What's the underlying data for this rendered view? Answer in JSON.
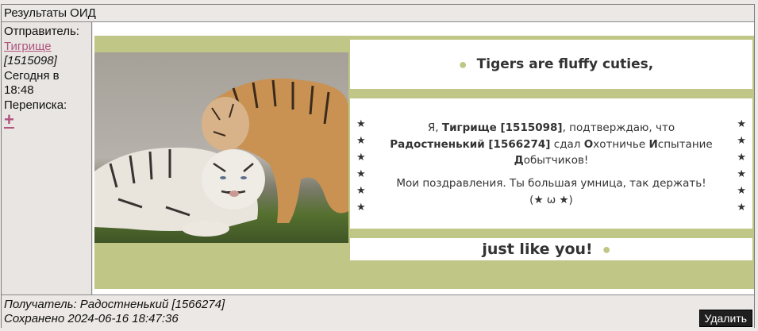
{
  "header": {
    "title": "Результаты ОИД"
  },
  "sender": {
    "label": "Отправитель:",
    "name": "Тигрище",
    "id": "[1515098]",
    "date_line1": "Сегодня в",
    "date_line2": "18:48",
    "correspondence_label": "Переписка:",
    "correspondence_action": "+"
  },
  "card": {
    "top_text": "Tigers are fluffy cuties,",
    "bottom_text": "just like you!",
    "message": {
      "p1_a": "Я, ",
      "p1_name": "Тигрище [1515098]",
      "p1_b": ", подтверждаю, что",
      "p1_name2": "Радостненький [1566274]",
      "p1_c": " сдал ",
      "o_letter": "О",
      "o_rest": "хотничье ",
      "i_letter": "И",
      "i_rest": "спытание",
      "d_letter": "Д",
      "d_rest": "обытчиков!",
      "p2": "Мои поздравления. Ты большая умница, так держать!",
      "p3": "(★ ω ★)"
    },
    "star": "★",
    "dot": "●"
  },
  "footer": {
    "recipient": "Получатель: Радостненький [1566274]",
    "saved": "Сохранено 2024-06-16 18:47:36",
    "delete_label": "Удалить"
  }
}
